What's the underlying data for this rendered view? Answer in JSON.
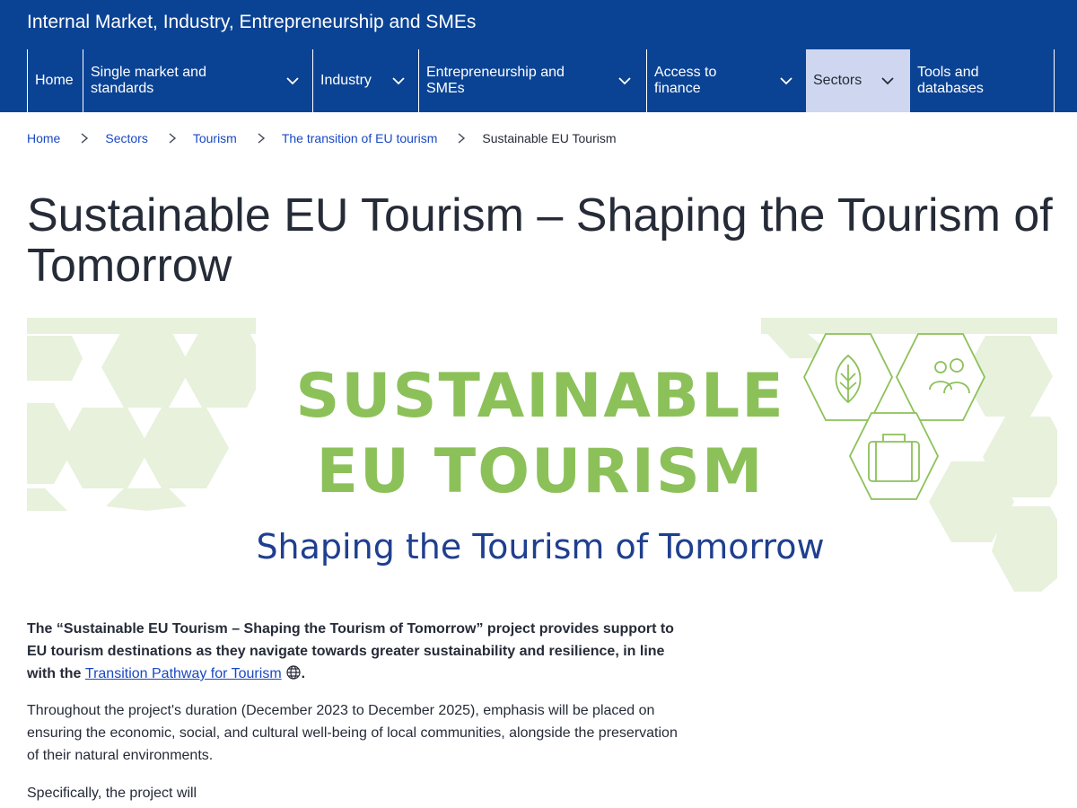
{
  "header": {
    "site_title": "Internal Market, Industry, Entrepreneurship and SMEs",
    "colors": {
      "brand_blue": "#0b4394",
      "active_tab_bg": "#cfd7f0",
      "link_blue": "#1a48c4",
      "banner_green": "#8cc15a",
      "banner_navy": "#1f3f8f"
    }
  },
  "nav": {
    "home": "Home",
    "single_market_1": "Single market and",
    "single_market_2": "standards",
    "industry": "Industry",
    "entrepreneurship_1": "Entrepreneurship and",
    "entrepreneurship_2": "SMEs",
    "access_1": "Access to",
    "access_2": "finance",
    "sectors": "Sectors",
    "tools_1": "Tools and",
    "tools_2": "databases"
  },
  "breadcrumb": {
    "home": "Home",
    "sectors": "Sectors",
    "tourism": "Tourism",
    "transition": "The transition of EU tourism",
    "current": "Sustainable EU Tourism"
  },
  "page": {
    "title": "Sustainable EU Tourism – Shaping the Tourism of Tomorrow"
  },
  "banner": {
    "line1": "SUSTAINABLE",
    "line2": "EU TOURISM",
    "tagline": "Shaping the Tourism of Tomorrow",
    "icons": [
      "leaf-icon",
      "people-icon",
      "suitcase-icon"
    ]
  },
  "content": {
    "intro_text": "The “Sustainable EU Tourism – Shaping the Tourism of Tomorrow” project provides support to EU tourism destinations as they navigate towards greater sustainability and resilience, in line with the ",
    "intro_link": "Transition Pathway for Tourism",
    "intro_end": ".",
    "paragraph1": "Throughout the project's duration (December 2023 to December 2025), emphasis will be placed on ensuring the economic, social, and cultural well-being of local communities, alongside the preservation of their natural environments.",
    "paragraph2": "Specifically, the project will"
  }
}
